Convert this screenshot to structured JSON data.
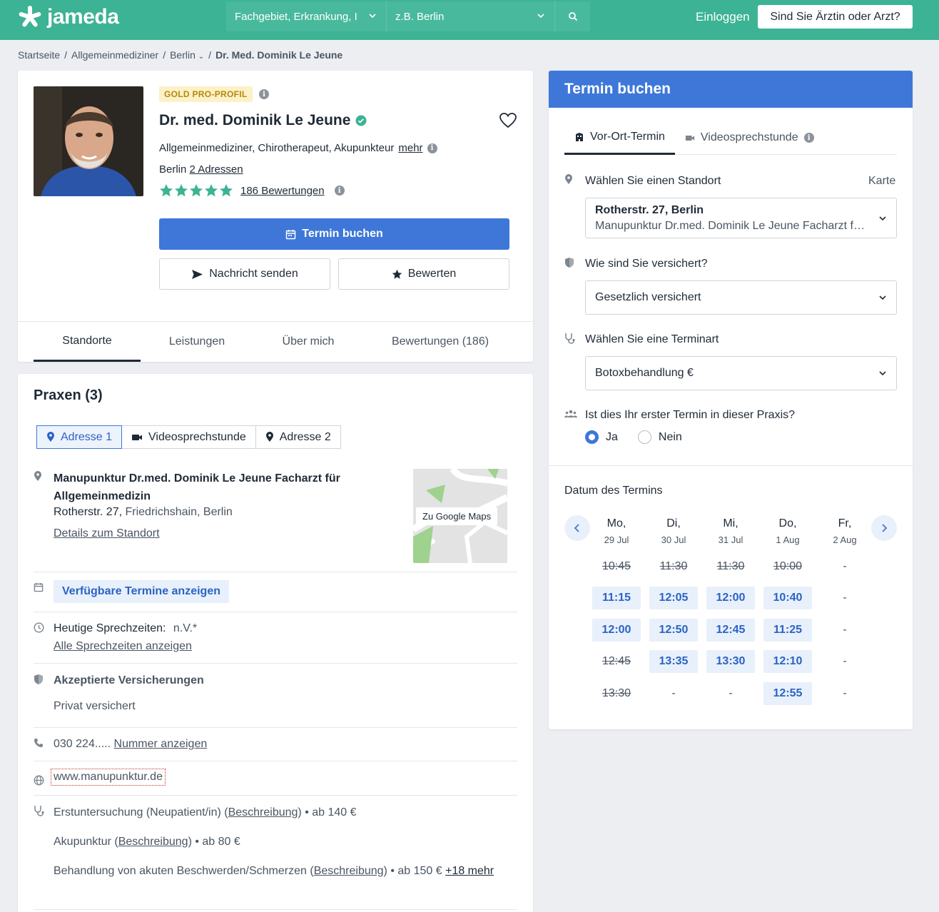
{
  "header": {
    "logo_text": "jameda",
    "search_specialty": "Fachgebiet, Erkrankung, I",
    "search_location": "z.B. Berlin",
    "login": "Einloggen",
    "doctor_cta": "Sind Sie Ärztin oder Arzt?"
  },
  "breadcrumb": {
    "items": [
      "Startseite",
      "Allgemeinmediziner",
      "Berlin"
    ],
    "separator": "/",
    "current": "Dr. Med. Dominik Le Jeune"
  },
  "profile": {
    "badge": "GOLD PRO-PROFIL",
    "name": "Dr. med. Dominik Le Jeune",
    "specialties": "Allgemeinmediziner, Chirotherapeut, Akupunkteur",
    "more_link": "mehr",
    "city": "Berlin",
    "addresses_link": "2 Adressen",
    "stars": 5,
    "reviews_link": "186 Bewertungen",
    "book_button": "Termin buchen",
    "message_button": "Nachricht senden",
    "rate_button": "Bewerten",
    "tabs": [
      "Standorte",
      "Leistungen",
      "Über mich",
      "Bewertungen (186)"
    ],
    "active_tab": "Standorte"
  },
  "praxen": {
    "title": "Praxen (3)",
    "address_tabs": [
      "Adresse 1",
      "Videosprechstunde",
      "Adresse 2"
    ],
    "practice_name": "Manupunktur Dr.med. Dominik Le Jeune Facharzt für Allgemeinmedizin",
    "street": "Rotherstr. 27,",
    "district": "Friedrichshain,",
    "city": "Berlin",
    "details_link": "Details zum Standort",
    "map_button": "Zu Google Maps",
    "available_button": "Verfügbare Termine anzeigen",
    "hours_label": "Heutige Sprechzeiten:",
    "hours_value": "n.V.*",
    "hours_link": "Alle Sprechzeiten anzeigen",
    "insurance_label": "Akzeptierte Versicherungen",
    "insurance_value": "Privat versichert",
    "phone": "030 224.....",
    "phone_link": "Nummer anzeigen",
    "website": "www.manupunktur.de",
    "services": [
      {
        "name": "Erstuntersuchung (Neupatient/in)",
        "desc": "Beschreibung",
        "price": "• ab 140 €"
      },
      {
        "name": "Akupunktur",
        "desc": "Beschreibung",
        "price": "• ab 80 €"
      },
      {
        "name": "Behandlung von akuten Beschwerden/Schmerzen",
        "desc": "Beschreibung",
        "price": "• ab 150 €"
      }
    ],
    "more_services": "+18 mehr"
  },
  "booking": {
    "title": "Termin buchen",
    "tab_onsite": "Vor-Ort-Termin",
    "tab_video": "Videosprechstunde",
    "location_label": "Wählen Sie einen Standort",
    "map_link": "Karte",
    "location_value": "Rotherstr. 27, Berlin",
    "location_sub": "Manupunktur Dr.med. Dominik Le Jeune Facharzt f…",
    "insurance_label": "Wie sind Sie versichert?",
    "insurance_value": "Gesetzlich versichert",
    "type_label": "Wählen Sie eine Terminart",
    "type_value": "Botoxbehandlung €",
    "first_label": "Ist dies Ihr erster Termin in dieser Praxis?",
    "yes": "Ja",
    "no": "Nein",
    "first_selected": "Ja",
    "date_label": "Datum des Termins",
    "days": [
      {
        "day": "Mo,",
        "date": "29 Jul",
        "slots": [
          {
            "t": "10:45",
            "s": "taken"
          },
          {
            "t": "11:15",
            "s": "free"
          },
          {
            "t": "12:00",
            "s": "free"
          },
          {
            "t": "12:45",
            "s": "taken"
          },
          {
            "t": "13:30",
            "s": "taken"
          }
        ]
      },
      {
        "day": "Di,",
        "date": "30 Jul",
        "slots": [
          {
            "t": "11:30",
            "s": "taken"
          },
          {
            "t": "12:05",
            "s": "free"
          },
          {
            "t": "12:50",
            "s": "free"
          },
          {
            "t": "13:35",
            "s": "free"
          },
          {
            "t": "-",
            "s": "none"
          }
        ]
      },
      {
        "day": "Mi,",
        "date": "31 Jul",
        "slots": [
          {
            "t": "11:30",
            "s": "taken"
          },
          {
            "t": "12:00",
            "s": "free"
          },
          {
            "t": "12:45",
            "s": "free"
          },
          {
            "t": "13:30",
            "s": "free"
          },
          {
            "t": "-",
            "s": "none"
          }
        ]
      },
      {
        "day": "Do,",
        "date": "1 Aug",
        "slots": [
          {
            "t": "10:00",
            "s": "taken"
          },
          {
            "t": "10:40",
            "s": "free"
          },
          {
            "t": "11:25",
            "s": "free"
          },
          {
            "t": "12:10",
            "s": "free"
          },
          {
            "t": "12:55",
            "s": "free"
          }
        ]
      },
      {
        "day": "Fr,",
        "date": "2 Aug",
        "slots": [
          {
            "t": "-",
            "s": "none"
          },
          {
            "t": "-",
            "s": "none"
          },
          {
            "t": "-",
            "s": "none"
          },
          {
            "t": "-",
            "s": "none"
          },
          {
            "t": "-",
            "s": "none"
          }
        ]
      }
    ]
  },
  "colors": {
    "brand": "#3cb394",
    "primary": "#3e77d8",
    "star": "#3cb394",
    "badge_bg": "#fcf1c7"
  }
}
